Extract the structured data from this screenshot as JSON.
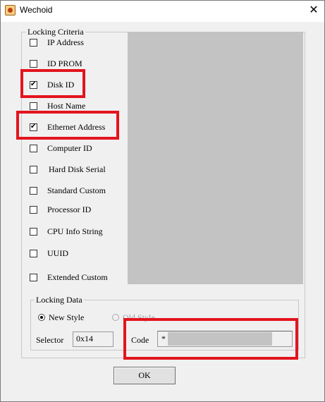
{
  "window": {
    "title": "Wechoid",
    "close_glyph": "✕",
    "app_icon": "wechoid-app-icon"
  },
  "locking_criteria": {
    "label": "Locking Criteria",
    "items": [
      {
        "label": "IP Address",
        "checked": false
      },
      {
        "label": "ID PROM",
        "checked": false
      },
      {
        "label": "Disk ID",
        "checked": true
      },
      {
        "label": "Host Name",
        "checked": false
      },
      {
        "label": "Ethernet Address",
        "checked": true
      },
      {
        "label": "Computer ID",
        "checked": false
      },
      {
        "label": "Hard Disk Serial",
        "checked": false
      },
      {
        "label": "Standard Custom",
        "checked": false
      },
      {
        "label": "Processor ID",
        "checked": false
      },
      {
        "label": "CPU Info String",
        "checked": false
      },
      {
        "label": "UUID",
        "checked": false
      },
      {
        "label": "Extended Custom",
        "checked": false
      }
    ]
  },
  "locking_data": {
    "label": "Locking Data",
    "new_style_label": "New Style",
    "new_style_selected": true,
    "old_style_label": "Old Style",
    "old_style_selected": false,
    "selector_label": "Selector",
    "selector_value": "0x14",
    "code_label": "Code",
    "code_value": "*"
  },
  "ok_button": {
    "label": "OK"
  },
  "colors": {
    "highlight": "#e3141e",
    "panel_gray": "#c3c3c3",
    "dialog_bg": "#f0f0f0"
  }
}
